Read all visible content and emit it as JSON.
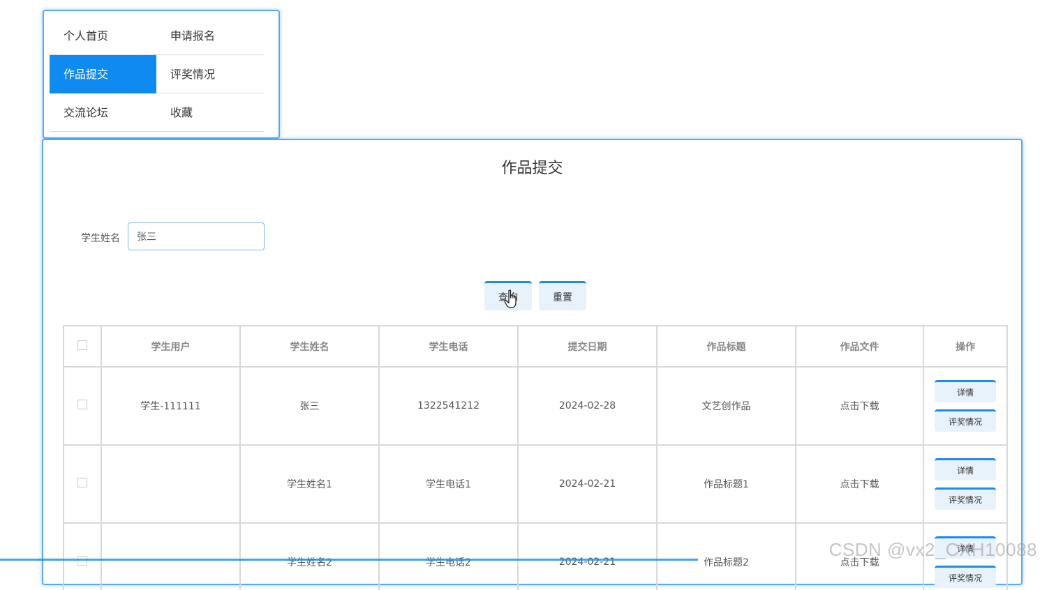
{
  "nav": {
    "items": [
      {
        "label": "个人首页",
        "active": false
      },
      {
        "label": "申请报名",
        "active": false
      },
      {
        "label": "作品提交",
        "active": true
      },
      {
        "label": "评奖情况",
        "active": false
      },
      {
        "label": "交流论坛",
        "active": false
      },
      {
        "label": "收藏",
        "active": false
      }
    ]
  },
  "main": {
    "title": "作品提交",
    "search": {
      "label": "学生姓名",
      "value": "张三"
    },
    "buttons": {
      "query": "查询",
      "reset": "重置"
    },
    "table": {
      "columns": [
        "学生用户",
        "学生姓名",
        "学生电话",
        "提交日期",
        "作品标题",
        "作品文件",
        "操作"
      ],
      "rows": [
        {
          "user": "学生-111111",
          "name": "张三",
          "phone": "1322541212",
          "date": "2024-02-28",
          "title": "文艺创作品",
          "file": "点击下载"
        },
        {
          "user": "",
          "name": "学生姓名1",
          "phone": "学生电话1",
          "date": "2024-02-21",
          "title": "作品标题1",
          "file": "点击下载"
        },
        {
          "user": "",
          "name": "学生姓名2",
          "phone": "学生电话2",
          "date": "2024-02-21",
          "title": "作品标题2",
          "file": "点击下载"
        }
      ],
      "row_actions": {
        "detail": "详情",
        "award": "评奖情况"
      }
    }
  },
  "watermark": "CSDN @vx2_CXH10088",
  "colors": {
    "accent": "#0f8af0",
    "card_border": "#5aa8f5",
    "button_bg": "#e8f2fb"
  }
}
